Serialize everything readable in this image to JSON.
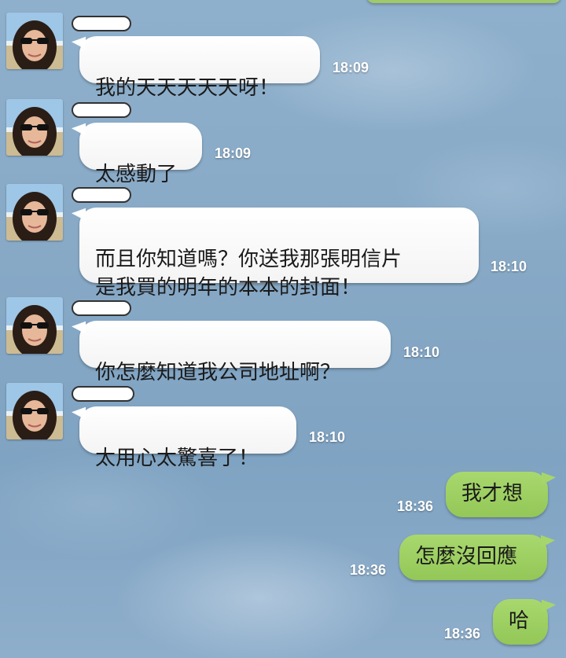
{
  "chat": {
    "incoming": [
      {
        "text": "我的天天天天天呀！",
        "time": "18:09"
      },
      {
        "text": "太感動了",
        "time": "18:09"
      },
      {
        "text": "而且你知道嗎？你送我那張明信片\n是我買的明年的本本的封面！",
        "time": "18:10"
      },
      {
        "text": "你怎麼知道我公司地址啊？",
        "time": "18:10"
      },
      {
        "text": "太用心太驚喜了！",
        "time": "18:10"
      }
    ],
    "outgoing": [
      {
        "text": "我才想",
        "time": "18:36"
      },
      {
        "text": "怎麼沒回應",
        "time": "18:36"
      },
      {
        "text": "哈",
        "time": "18:36"
      }
    ]
  },
  "colors": {
    "incoming_bubble": "#ffffff",
    "outgoing_bubble": "#9fcf62",
    "timestamp": "#ffffff",
    "background": "#87a9c6"
  },
  "icons": {
    "avatar": "user-avatar-photo"
  }
}
